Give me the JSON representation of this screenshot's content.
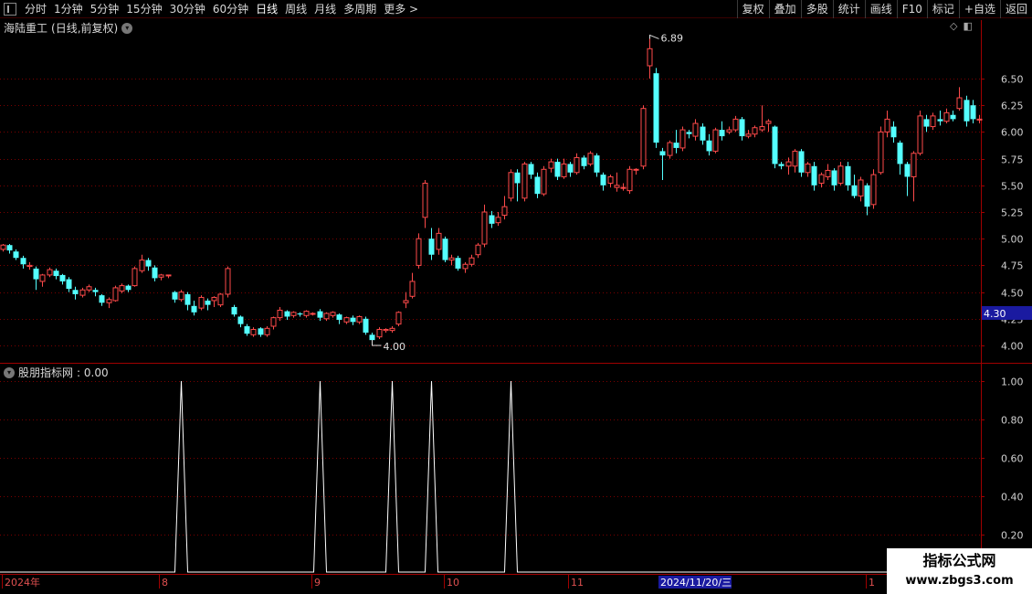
{
  "toolbar": {
    "left": [
      "分时",
      "1分钟",
      "5分钟",
      "15分钟",
      "30分钟",
      "60分钟",
      "日线",
      "周线",
      "月线",
      "多周期",
      "更多 >"
    ],
    "active": "日线",
    "right": [
      "复权",
      "叠加",
      "多股",
      "统计",
      "画线",
      "F10",
      "标记",
      "+自选",
      "返回"
    ]
  },
  "stock": {
    "name": "海陆重工",
    "mode": "(日线,前复权)"
  },
  "price_axis": {
    "ticks": [
      "6.50",
      "6.25",
      "6.00",
      "5.75",
      "5.50",
      "5.25",
      "5.00",
      "4.75",
      "4.50",
      "4.25",
      "4.00"
    ],
    "current": "4.30",
    "high_label": "6.89",
    "low_label": "4.00"
  },
  "indicator": {
    "name": "股朋指标网",
    "value_label": ": 0.00",
    "ticks": [
      "1.00",
      "0.80",
      "0.60",
      "0.40",
      "0.20"
    ]
  },
  "date_axis": {
    "labels": [
      "2024年",
      "8",
      "9",
      "10",
      "11",
      "2024/11/20/三",
      "1"
    ]
  },
  "watermark": {
    "line1": "指标公式网",
    "line2": "www.zbgs3.com"
  },
  "colors": {
    "up": "#ff4a4a",
    "down": "#54ffff",
    "grid": "#7a0000",
    "axis": "#a00000",
    "bg": "#000000"
  },
  "chart_data": {
    "type": "candlestick",
    "price_range": [
      3.9,
      6.95
    ],
    "candles": [
      [
        4.9,
        4.94,
        4.88,
        4.95
      ],
      [
        4.94,
        4.89,
        4.86,
        4.95
      ],
      [
        4.88,
        4.82,
        4.8,
        4.9
      ],
      [
        4.82,
        4.76,
        4.72,
        4.84
      ],
      [
        4.74,
        4.75,
        4.71,
        4.78
      ],
      [
        4.72,
        4.62,
        4.52,
        4.74
      ],
      [
        4.6,
        4.66,
        4.55,
        4.67
      ],
      [
        4.66,
        4.71,
        4.64,
        4.73
      ],
      [
        4.7,
        4.65,
        4.62,
        4.72
      ],
      [
        4.66,
        4.6,
        4.57,
        4.67
      ],
      [
        4.62,
        4.53,
        4.5,
        4.64
      ],
      [
        4.52,
        4.48,
        4.43,
        4.55
      ],
      [
        4.47,
        4.52,
        4.45,
        4.54
      ],
      [
        4.52,
        4.55,
        4.5,
        4.57
      ],
      [
        4.52,
        4.5,
        4.46,
        4.54
      ],
      [
        4.47,
        4.4,
        4.37,
        4.48
      ],
      [
        4.4,
        4.43,
        4.35,
        4.45
      ],
      [
        4.42,
        4.54,
        4.41,
        4.56
      ],
      [
        4.51,
        4.56,
        4.49,
        4.58
      ],
      [
        4.56,
        4.52,
        4.5,
        4.57
      ],
      [
        4.56,
        4.72,
        4.55,
        4.74
      ],
      [
        4.7,
        4.8,
        4.68,
        4.85
      ],
      [
        4.8,
        4.74,
        4.7,
        4.82
      ],
      [
        4.73,
        4.63,
        4.6,
        4.75
      ],
      [
        4.64,
        4.66,
        4.61,
        4.67
      ],
      [
        4.66,
        4.66,
        4.63,
        4.66
      ],
      [
        4.5,
        4.43,
        4.4,
        4.51
      ],
      [
        4.43,
        4.5,
        4.41,
        4.52
      ],
      [
        4.48,
        4.38,
        4.33,
        4.5
      ],
      [
        4.37,
        4.31,
        4.28,
        4.42
      ],
      [
        4.35,
        4.45,
        4.33,
        4.47
      ],
      [
        4.42,
        4.38,
        4.33,
        4.44
      ],
      [
        4.42,
        4.45,
        4.36,
        4.46
      ],
      [
        4.38,
        4.48,
        4.36,
        4.49
      ],
      [
        4.48,
        4.72,
        4.45,
        4.74
      ],
      [
        4.36,
        4.29,
        4.27,
        4.38
      ],
      [
        4.27,
        4.2,
        4.17,
        4.28
      ],
      [
        4.18,
        4.11,
        4.09,
        4.2
      ],
      [
        4.1,
        4.15,
        4.08,
        4.17
      ],
      [
        4.16,
        4.1,
        4.08,
        4.17
      ],
      [
        4.1,
        4.16,
        4.08,
        4.18
      ],
      [
        4.18,
        4.26,
        4.15,
        4.27
      ],
      [
        4.26,
        4.33,
        4.23,
        4.36
      ],
      [
        4.32,
        4.27,
        4.24,
        4.33
      ],
      [
        4.28,
        4.31,
        4.26,
        4.32
      ],
      [
        4.3,
        4.29,
        4.27,
        4.31
      ],
      [
        4.28,
        4.32,
        4.26,
        4.33
      ],
      [
        4.3,
        4.3,
        4.28,
        4.31
      ],
      [
        4.32,
        4.26,
        4.23,
        4.34
      ],
      [
        4.25,
        4.3,
        4.23,
        4.31
      ],
      [
        4.28,
        4.31,
        4.26,
        4.32
      ],
      [
        4.29,
        4.24,
        4.2,
        4.3
      ],
      [
        4.22,
        4.26,
        4.2,
        4.27
      ],
      [
        4.26,
        4.22,
        4.19,
        4.28
      ],
      [
        4.22,
        4.27,
        4.2,
        4.28
      ],
      [
        4.25,
        4.12,
        4.1,
        4.27
      ],
      [
        4.1,
        4.05,
        4.0,
        4.12
      ],
      [
        4.08,
        4.15,
        4.06,
        4.17
      ],
      [
        4.14,
        4.15,
        4.12,
        4.16
      ],
      [
        4.14,
        4.16,
        4.12,
        4.18
      ],
      [
        4.2,
        4.31,
        4.18,
        4.32
      ],
      [
        4.4,
        4.42,
        4.35,
        4.5
      ],
      [
        4.46,
        4.6,
        4.44,
        4.68
      ],
      [
        4.75,
        5.0,
        4.72,
        5.05
      ],
      [
        5.2,
        5.52,
        5.1,
        5.55
      ],
      [
        5.0,
        4.85,
        4.8,
        5.1
      ],
      [
        4.9,
        5.05,
        4.85,
        5.1
      ],
      [
        5.0,
        4.8,
        4.78,
        5.02
      ],
      [
        4.8,
        4.82,
        4.75,
        4.85
      ],
      [
        4.82,
        4.72,
        4.7,
        4.84
      ],
      [
        4.72,
        4.76,
        4.68,
        4.78
      ],
      [
        4.76,
        4.82,
        4.74,
        4.85
      ],
      [
        4.85,
        4.94,
        4.82,
        4.96
      ],
      [
        4.95,
        5.25,
        4.92,
        5.32
      ],
      [
        5.22,
        5.14,
        5.1,
        5.26
      ],
      [
        5.15,
        5.2,
        5.12,
        5.25
      ],
      [
        5.22,
        5.3,
        5.18,
        5.4
      ],
      [
        5.38,
        5.62,
        5.35,
        5.65
      ],
      [
        5.62,
        5.52,
        5.35,
        5.65
      ],
      [
        5.38,
        5.7,
        5.35,
        5.72
      ],
      [
        5.7,
        5.6,
        5.56,
        5.72
      ],
      [
        5.58,
        5.42,
        5.38,
        5.62
      ],
      [
        5.42,
        5.65,
        5.4,
        5.68
      ],
      [
        5.66,
        5.72,
        5.62,
        5.75
      ],
      [
        5.72,
        5.58,
        5.55,
        5.75
      ],
      [
        5.58,
        5.7,
        5.56,
        5.75
      ],
      [
        5.7,
        5.62,
        5.58,
        5.72
      ],
      [
        5.62,
        5.76,
        5.6,
        5.8
      ],
      [
        5.76,
        5.68,
        5.65,
        5.78
      ],
      [
        5.7,
        5.8,
        5.68,
        5.82
      ],
      [
        5.78,
        5.62,
        5.58,
        5.8
      ],
      [
        5.6,
        5.5,
        5.45,
        5.62
      ],
      [
        5.52,
        5.58,
        5.48,
        5.6
      ],
      [
        5.48,
        5.5,
        5.44,
        5.62
      ],
      [
        5.48,
        5.48,
        5.45,
        5.52
      ],
      [
        5.45,
        5.65,
        5.42,
        5.68
      ],
      [
        5.65,
        5.65,
        5.6,
        5.66
      ],
      [
        5.68,
        6.22,
        5.65,
        6.25
      ],
      [
        6.62,
        6.78,
        6.5,
        6.89
      ],
      [
        6.55,
        5.9,
        5.85,
        6.6
      ],
      [
        5.82,
        5.78,
        5.55,
        5.85
      ],
      [
        5.78,
        5.9,
        5.75,
        5.92
      ],
      [
        5.9,
        5.85,
        5.8,
        6.02
      ],
      [
        5.85,
        6.02,
        5.82,
        6.05
      ],
      [
        6.0,
        5.98,
        5.94,
        6.02
      ],
      [
        5.96,
        6.08,
        5.92,
        6.12
      ],
      [
        6.05,
        5.92,
        5.88,
        6.08
      ],
      [
        5.92,
        5.82,
        5.78,
        5.98
      ],
      [
        5.82,
        6.02,
        5.8,
        6.04
      ],
      [
        6.02,
        5.96,
        5.92,
        6.1
      ],
      [
        6.0,
        6.02,
        5.98,
        6.05
      ],
      [
        6.02,
        6.12,
        6.0,
        6.15
      ],
      [
        6.12,
        5.96,
        5.92,
        6.14
      ],
      [
        5.96,
        5.98,
        5.94,
        6.02
      ],
      [
        5.98,
        6.04,
        5.95,
        6.06
      ],
      [
        6.02,
        6.05,
        6.0,
        6.25
      ],
      [
        6.08,
        6.1,
        6.0,
        6.12
      ],
      [
        6.05,
        5.7,
        5.66,
        6.06
      ],
      [
        5.7,
        5.68,
        5.65,
        5.72
      ],
      [
        5.68,
        5.72,
        5.6,
        5.76
      ],
      [
        5.68,
        5.82,
        5.62,
        5.84
      ],
      [
        5.82,
        5.62,
        5.58,
        5.84
      ],
      [
        5.62,
        5.7,
        5.58,
        5.72
      ],
      [
        5.68,
        5.5,
        5.45,
        5.72
      ],
      [
        5.52,
        5.6,
        5.48,
        5.62
      ],
      [
        5.58,
        5.64,
        5.55,
        5.7
      ],
      [
        5.64,
        5.5,
        5.45,
        5.66
      ],
      [
        5.52,
        5.68,
        5.5,
        5.72
      ],
      [
        5.68,
        5.5,
        5.45,
        5.72
      ],
      [
        5.5,
        5.4,
        5.38,
        5.6
      ],
      [
        5.4,
        5.55,
        5.35,
        5.58
      ],
      [
        5.5,
        5.3,
        5.22,
        5.52
      ],
      [
        5.32,
        5.6,
        5.28,
        5.65
      ],
      [
        5.62,
        6.0,
        5.6,
        6.05
      ],
      [
        6.0,
        6.12,
        5.95,
        6.2
      ],
      [
        6.05,
        5.95,
        5.9,
        6.1
      ],
      [
        5.9,
        5.7,
        5.6,
        5.92
      ],
      [
        5.7,
        5.58,
        5.4,
        5.72
      ],
      [
        5.58,
        5.8,
        5.35,
        5.82
      ],
      [
        5.8,
        6.15,
        5.78,
        6.2
      ],
      [
        6.12,
        6.05,
        6.0,
        6.16
      ],
      [
        6.05,
        6.15,
        6.02,
        6.18
      ],
      [
        6.12,
        6.1,
        6.06,
        6.2
      ],
      [
        6.1,
        6.18,
        6.08,
        6.22
      ],
      [
        6.16,
        6.12,
        6.1,
        6.2
      ],
      [
        6.22,
        6.32,
        6.2,
        6.42
      ],
      [
        6.3,
        6.1,
        6.05,
        6.34
      ],
      [
        6.25,
        6.12,
        6.08,
        6.3
      ],
      [
        6.12,
        6.12,
        6.08,
        6.16
      ]
    ],
    "indicator_series": {
      "peaks_at_index": [
        27,
        48,
        59,
        65,
        77
      ],
      "values": "0 except peaks reaching 1.00"
    }
  }
}
